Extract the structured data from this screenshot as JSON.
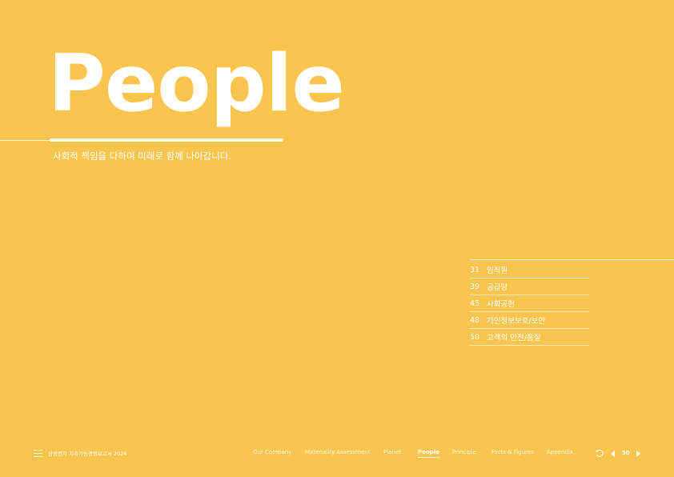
{
  "hero": {
    "title": "People",
    "subtitle": "사회적 책임을 다하며 미래로 함께 나아갑니다."
  },
  "toc": [
    {
      "num": "31",
      "label": "임직원"
    },
    {
      "num": "39",
      "label": "공급망"
    },
    {
      "num": "45",
      "label": "사회공헌"
    },
    {
      "num": "48",
      "label": "개인정보보호/보안"
    },
    {
      "num": "50",
      "label": "고객의 안전/품질"
    }
  ],
  "footer": {
    "report_title": "삼성전자 지속가능경영보고서 2024",
    "nav": [
      "Our Company",
      "Materiality Assessment",
      "Planet",
      "People",
      "Principle",
      "Facts & Figures",
      "Appendix"
    ],
    "active_nav": "People",
    "page_number": "30"
  },
  "colors": {
    "background": "#f9c54e",
    "text": "#ffffff"
  },
  "icons": [
    "menu-icon",
    "undo-icon",
    "prev-page-icon",
    "next-page-icon"
  ]
}
